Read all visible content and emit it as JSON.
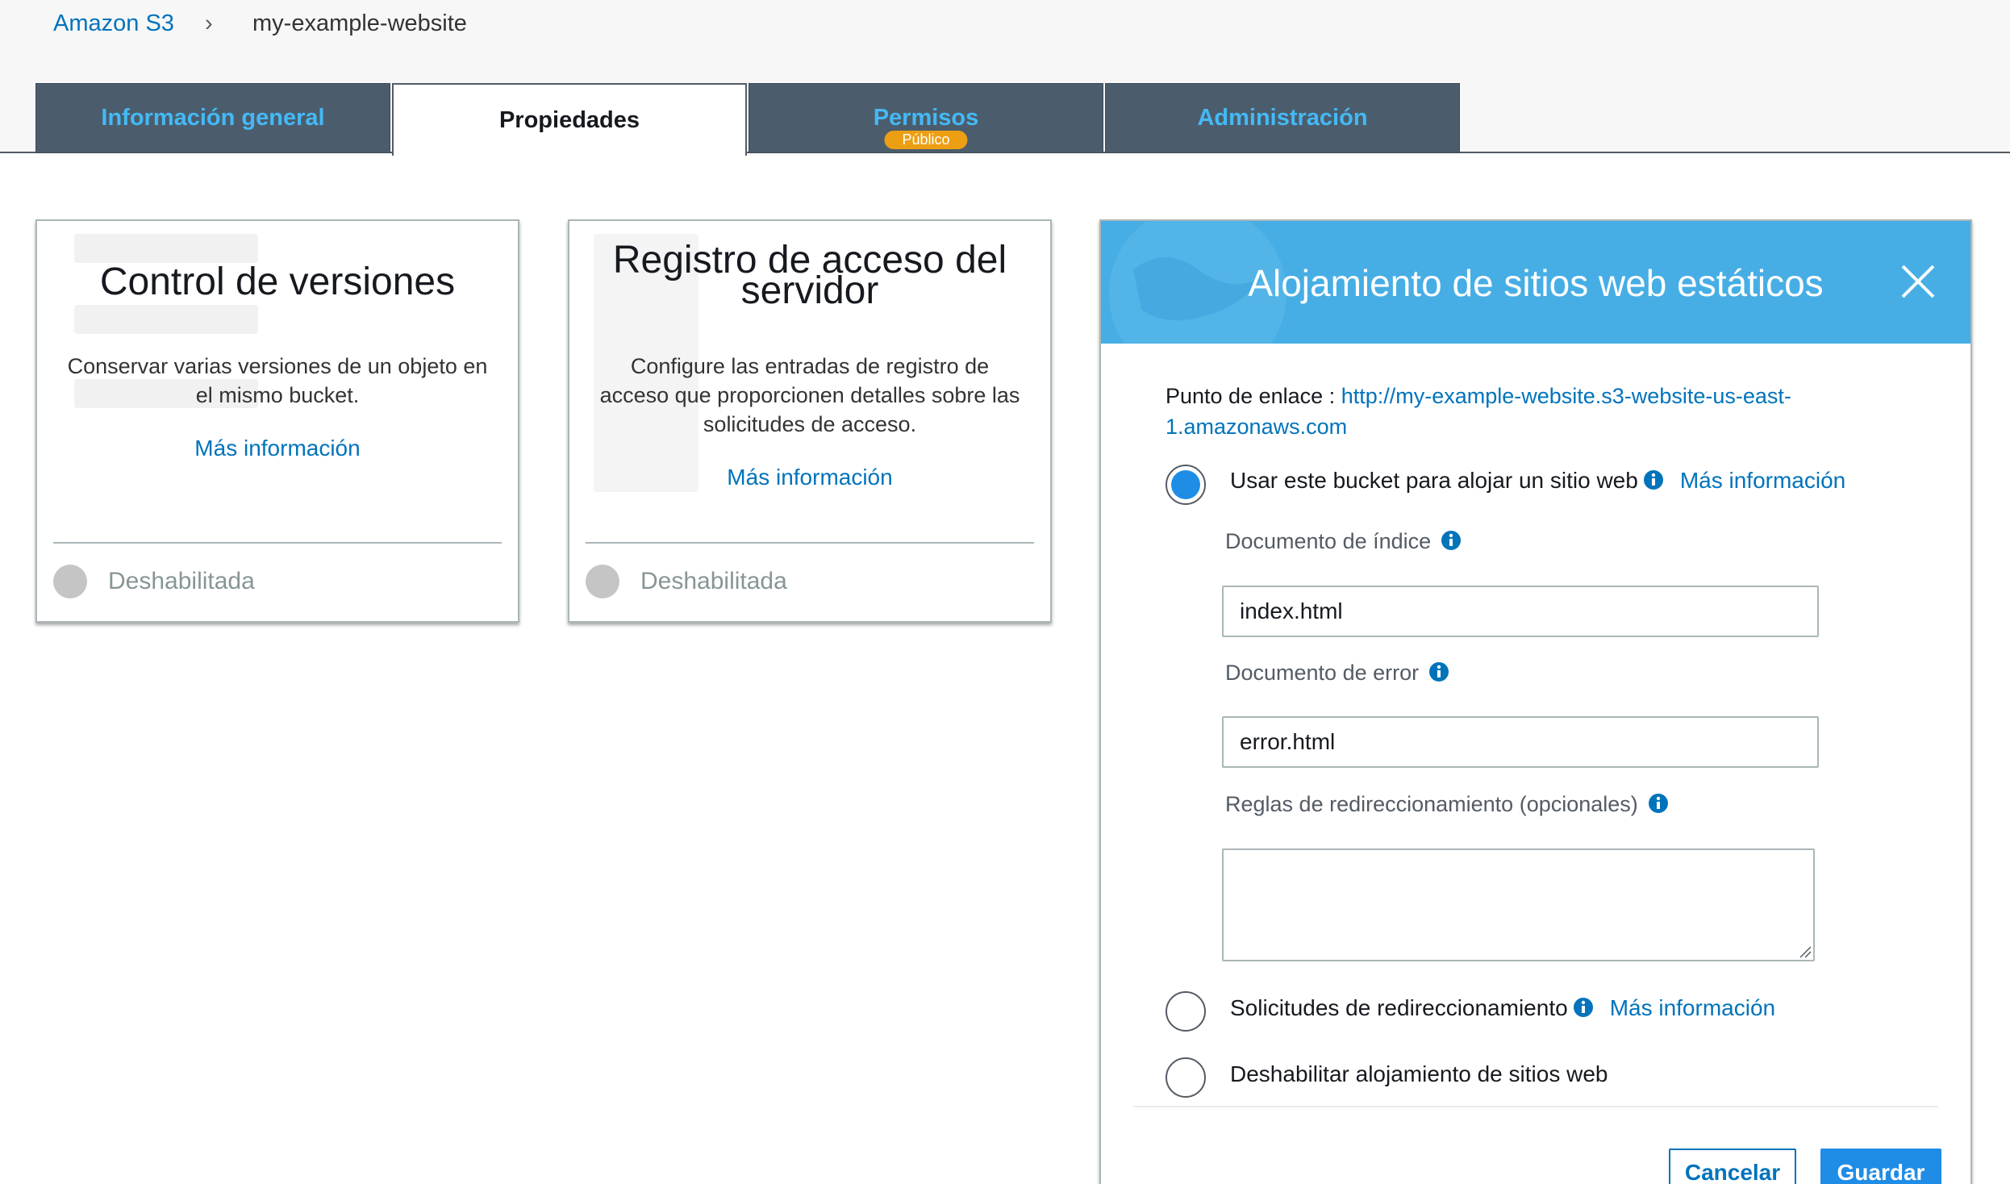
{
  "breadcrumb": {
    "root": "Amazon S3",
    "separator": "›",
    "current": "my-example-website"
  },
  "tabs": [
    {
      "label": "Información general",
      "active": false
    },
    {
      "label": "Propiedades",
      "active": true
    },
    {
      "label": "Permisos",
      "active": false,
      "badge": "Público"
    },
    {
      "label": "Administración",
      "active": false
    }
  ],
  "cards": {
    "versioning": {
      "title": "Control de versiones",
      "description": "Conservar varias versiones de un objeto en el mismo bucket.",
      "more_link": "Más información",
      "status": "Deshabilitada"
    },
    "logging": {
      "title_line1": "Registro de acceso del",
      "title_line2": "servidor",
      "description": "Configure las entradas de registro de acceso que proporcionen detalles sobre las solicitudes de acceso.",
      "more_link": "Más información",
      "status": "Deshabilitada"
    }
  },
  "website_panel": {
    "title": "Alojamiento de sitios web estáticos",
    "endpoint_label": "Punto de enlace :",
    "endpoint_url": "http://my-example-website.s3-website-us-east-1.amazonaws.com",
    "options": {
      "use_bucket": {
        "label": "Usar este bucket para alojar un sitio web",
        "more": "Más información",
        "selected": true
      },
      "redirect": {
        "label": "Solicitudes de redireccionamiento",
        "more": "Más información",
        "selected": false
      },
      "disable": {
        "label": "Deshabilitar alojamiento de sitios web",
        "selected": false
      }
    },
    "index_document": {
      "label": "Documento de índice",
      "value": "index.html"
    },
    "error_document": {
      "label": "Documento de error",
      "value": "error.html"
    },
    "redirect_rules": {
      "label": "Reglas de redireccionamiento (opcionales)",
      "value": ""
    },
    "buttons": {
      "cancel": "Cancelar",
      "save": "Guardar"
    }
  },
  "colors": {
    "link": "#0073bb",
    "tab_background": "#4b5d6c",
    "tab_text": "#44b9f5",
    "badge": "#ec9f13",
    "panel_header": "#47aee5",
    "primary_button": "#1f8de6"
  },
  "icons": [
    "info-icon",
    "close-icon",
    "chevron-right-icon"
  ]
}
